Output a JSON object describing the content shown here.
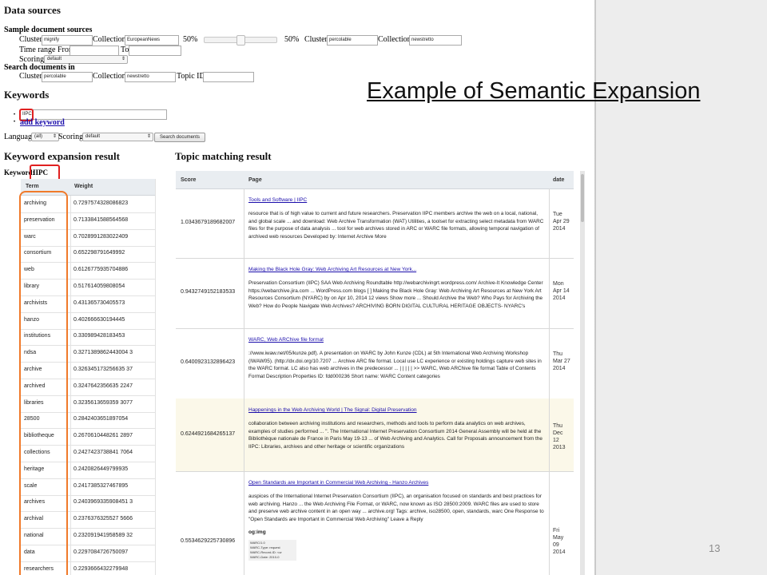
{
  "slide": {
    "title": "Example of Semantic Expansion",
    "page_number": "13"
  },
  "data_sources": {
    "heading": "Data sources",
    "sample_heading": "Sample document sources",
    "cluster_label": "Cluster",
    "cluster_value": "mignify",
    "collection_label": "Collection",
    "collection_value": "EuropeanNews",
    "slider_left_pct": "50%",
    "slider_right_pct": "50%",
    "cluster2_label": "Cluster",
    "cluster2_value": "percolable",
    "collection2_label": "Collection",
    "collection2_value": "newstretto",
    "time_range_label": "Time range From",
    "to_label": "To",
    "scoring_label": "Scoring",
    "scoring_value": "default",
    "search_heading": "Search documents in",
    "search_cluster_label": "Cluster",
    "search_cluster_value": "percolable",
    "search_collection_label": "Collection",
    "search_collection_value": "newstretto",
    "topic_id_label": "Topic ID"
  },
  "keywords": {
    "heading": "Keywords",
    "keyword_value": "IIPC",
    "add_keyword": "add keyword",
    "language_label": "Language",
    "language_value": "(all)",
    "scoring_label": "Scoring",
    "scoring_value": "default",
    "search_button": "Search documents"
  },
  "expansion": {
    "heading": "Keyword expansion result",
    "keyword_label": "Keyword:",
    "keyword": "IIPC",
    "col_term": "Term",
    "col_weight": "Weight",
    "rows": [
      {
        "term": "archiving",
        "weight": "0.7297574328086823"
      },
      {
        "term": "preservation",
        "weight": "0.7133841588564568"
      },
      {
        "term": "warc",
        "weight": "0.7028991283022409"
      },
      {
        "term": "consortium",
        "weight": "0.652298791649992"
      },
      {
        "term": "web",
        "weight": "0.6126775935704886"
      },
      {
        "term": "library",
        "weight": "0.517614059808054"
      },
      {
        "term": "archivists",
        "weight": "0.431365730405573"
      },
      {
        "term": "hanzo",
        "weight": "0.402666630194445"
      },
      {
        "term": "institutions",
        "weight": "0.330989428183453"
      },
      {
        "term": "ndsa",
        "weight": "0.3271389862443004 3"
      },
      {
        "term": "archive",
        "weight": "0.326345173256635 37"
      },
      {
        "term": "archived",
        "weight": "0.3247642356635 2247"
      },
      {
        "term": "libraries",
        "weight": "0.3235613659359 3077"
      },
      {
        "term": "28500",
        "weight": "0.2842403651897054"
      },
      {
        "term": "bibliotheque",
        "weight": "0.2670610448261 2897"
      },
      {
        "term": "collections",
        "weight": "0.2427423738841 7064"
      },
      {
        "term": "heritage",
        "weight": "0.2420826449799935"
      },
      {
        "term": "scale",
        "weight": "0.2417385327467895"
      },
      {
        "term": "archives",
        "weight": "0.2403969335908451 3"
      },
      {
        "term": "archival",
        "weight": "0.2376376325527 5666"
      },
      {
        "term": "national",
        "weight": "0.232091941958589 32"
      },
      {
        "term": "data",
        "weight": "0.2297084726750097"
      },
      {
        "term": "researchers",
        "weight": "0.2293666432279948"
      }
    ]
  },
  "topic": {
    "heading": "Topic matching result",
    "col_score": "Score",
    "col_page": "Page",
    "col_date": "date",
    "rows": [
      {
        "score": "1.0343679189682007",
        "title": "Tools and Software | IIPC",
        "snippet": "resource that is of high value to current and future researchers. Preservation IIPC members archive the web on a local, national, and global scale ... and download: Web Archive Transformation (WAT) Utilities, a toolset for extracting select metadata from WARC files for the purpose of data analysis ... tool for web archives stored in ARC or WARC file formats, allowing temporal navigation of archived web resources Developed by: Internet Archive More",
        "date": "Tue Apr 29 2014"
      },
      {
        "score": "0.9432749152183533",
        "title": "Making the Black Hole Gray: Web Archiving Art Resources at New York...",
        "snippet": "Preservation Consortium (IIPC) SAA Web Archiving Roundtable http://webarchivingrt.wordpress.com/ Archive-It Knowledge Center https://webarchive.jira.com ... WordPress.com blogs [ ] Making the Black Hole Gray: Web Archiving Art Resources at New York Art Resources Consortium (NYARC) by on Apr 10, 2014 12 views Show more ... Should Archive the Web? Who Pays for Archiving the Web? How do People Navigate Web Archives? ARCHIVING BORN DIGITAL CULTURAL HERITAGE OBJECTS- NYARC's",
        "date": "Mon Apr 14 2014"
      },
      {
        "score": "0.6400923132896423",
        "title": "WARC, Web ARChive file format",
        "snippet": "://www.iwaw.net/05/kunze.pdf). A presentation on WARC by John Kunze (CDL) at 5th International Web Archiving Workshop (IWAW05). (http://dx.doi.org/10.7207 ... Archive ARC file format. Local use LC experience or existing holdings capture web sites in the WARC format. LC also has web archives in the predecessor ... | | | | | >> WARC, Web ARChive file format Table of Contents Format Description Properties ID: fdd000236 Short name: WARC Content categories",
        "date": "Thu Mar 27 2014"
      },
      {
        "score": "0.6244921684265137",
        "title": "Happenings in the Web Archiving World | The Signal: Digital Preservation",
        "snippet": "collaboration between archiving institutions and researchers, methods and tools to perform data analytics on web archives, examples of studies performed ... \". The International Internet Preservation Consortium 2014 General Assembly will be held at the Bibliothèque nationale de France in Paris May 19-13 ... of Web Archiving and Analytics. Call for Proposals announcement from the IIPC: Libraries, archives and other heritage or scientific organizations",
        "date": "Thu Dec 12 2013"
      },
      {
        "score": "0.5534629225730896",
        "title": "Open Standards are Important in Commercial Web Archiving - Hanzo Archives",
        "snippet": "auspices of the International Internet Preservation Consortium (IIPC), an organisation focused on standards and best practices for web archiving. Hanzo ... the Web Archiving File Format, or WARC, now known as ISO 28500:2009. WARC files are used to store and preserve web archive content in an open way ... archive.org! Tags: archive, iso28500, open, standards, warc One Response to \"Open Standards are Important in Commercial Web Archiving\" Leave a Reply",
        "og": "og:img",
        "warc_lines": [
          "WARC/1.0",
          "WARC-Type: request",
          "WARC-Record-ID: <ur",
          "WARC-Date: 2010-0"
        ],
        "date": "Fri May 09 2014"
      }
    ]
  }
}
